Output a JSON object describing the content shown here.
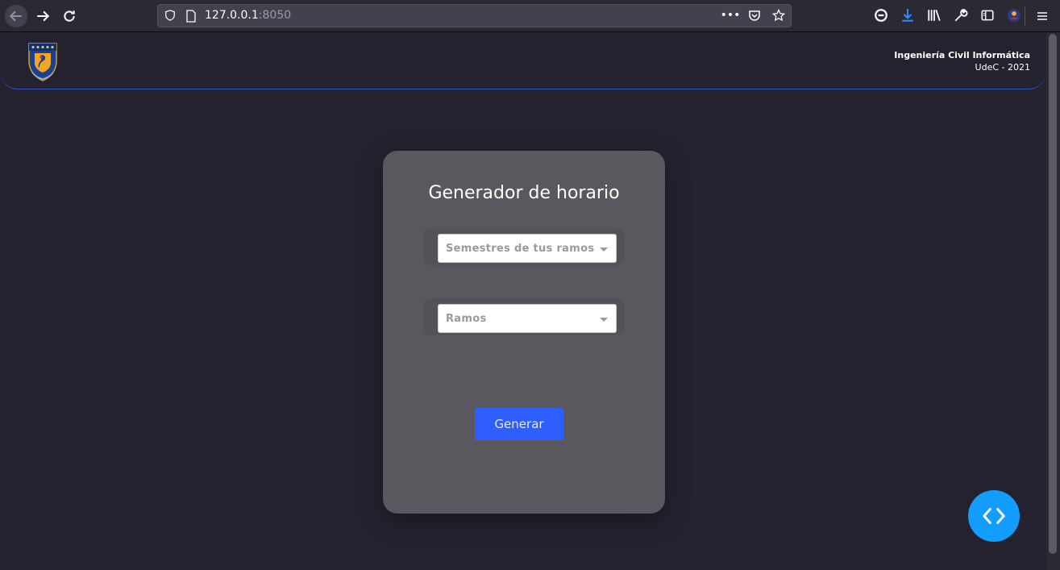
{
  "browser": {
    "url_host": "127.0.0.1",
    "url_port": ":8050"
  },
  "header": {
    "title": "Ingeniería Civil Informática",
    "subtitle": "UdeC - 2021"
  },
  "card": {
    "title": "Generador de horario",
    "semestres_placeholder": "Semestres de tus ramos",
    "ramos_placeholder": "Ramos",
    "generate_label": "Generar"
  },
  "colors": {
    "background": "#24222f",
    "card": "#5a585f",
    "accent": "#2f5eff",
    "fab": "#139dff"
  },
  "icons": {
    "fab": "code-brackets-icon"
  }
}
